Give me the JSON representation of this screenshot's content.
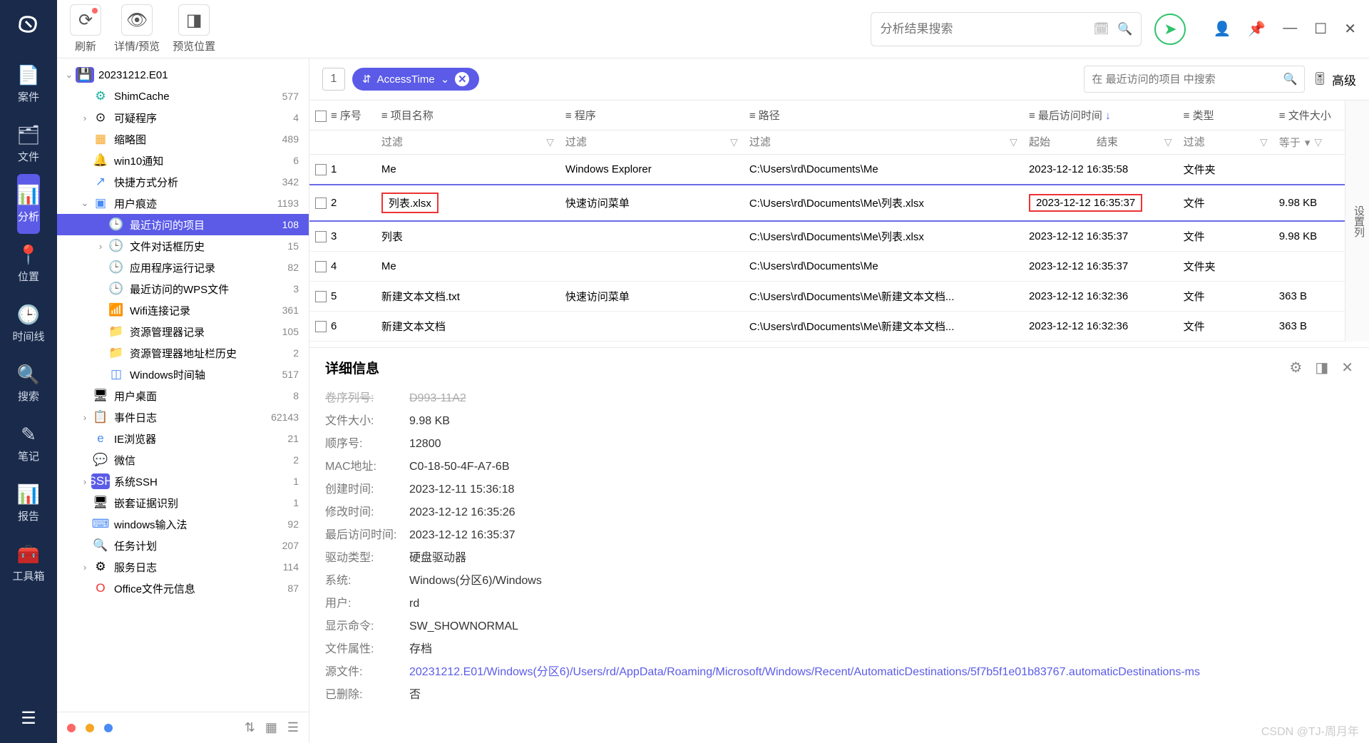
{
  "nav": [
    {
      "icon": "📄",
      "label": "案件"
    },
    {
      "icon": "🗂",
      "label": "文件"
    },
    {
      "icon": "📊",
      "label": "分析",
      "active": true
    },
    {
      "icon": "📍",
      "label": "位置"
    },
    {
      "icon": "🕒",
      "label": "时间线"
    },
    {
      "icon": "🔍",
      "label": "搜索"
    },
    {
      "icon": "✎",
      "label": "笔记"
    },
    {
      "icon": "📊",
      "label": "报告"
    },
    {
      "icon": "🧰",
      "label": "工具箱"
    }
  ],
  "toolbar": {
    "refresh": "刷新",
    "detail_preview": "详情/预览",
    "preview_pos": "预览位置",
    "search_placeholder": "分析结果搜索"
  },
  "tree": {
    "root": "20231212.E01",
    "items": [
      {
        "indent": 1,
        "chev": "",
        "icon": "⚙",
        "iconCls": "ic-teal",
        "label": "ShimCache",
        "count": "577"
      },
      {
        "indent": 1,
        "chev": "›",
        "icon": "⊙",
        "iconCls": "",
        "label": "可疑程序",
        "count": "4"
      },
      {
        "indent": 1,
        "chev": "",
        "icon": "▦",
        "iconCls": "ic-orange",
        "label": "缩略图",
        "count": "489"
      },
      {
        "indent": 1,
        "chev": "",
        "icon": "🔔",
        "iconCls": "ic-blue",
        "label": "win10通知",
        "count": "6"
      },
      {
        "indent": 1,
        "chev": "",
        "icon": "↗",
        "iconCls": "ic-blue",
        "label": "快捷方式分析",
        "count": "342"
      },
      {
        "indent": 1,
        "chev": "⌄",
        "icon": "▣",
        "iconCls": "ic-blue",
        "label": "用户痕迹",
        "count": "1193"
      },
      {
        "indent": 2,
        "chev": "",
        "icon": "🕒",
        "iconCls": "ic-orange",
        "label": "最近访问的项目",
        "count": "108",
        "active": true
      },
      {
        "indent": 2,
        "chev": "›",
        "icon": "🕒",
        "iconCls": "ic-orange",
        "label": "文件对话框历史",
        "count": "15"
      },
      {
        "indent": 2,
        "chev": "",
        "icon": "🕒",
        "iconCls": "ic-orange",
        "label": "应用程序运行记录",
        "count": "82"
      },
      {
        "indent": 2,
        "chev": "",
        "icon": "🕒",
        "iconCls": "ic-orange",
        "label": "最近访问的WPS文件",
        "count": "3"
      },
      {
        "indent": 2,
        "chev": "",
        "icon": "📶",
        "iconCls": "ic-blue",
        "label": "Wifi连接记录",
        "count": "361"
      },
      {
        "indent": 2,
        "chev": "",
        "icon": "📁",
        "iconCls": "ic-fold",
        "label": "资源管理器记录",
        "count": "105"
      },
      {
        "indent": 2,
        "chev": "",
        "icon": "📁",
        "iconCls": "ic-fold",
        "label": "资源管理器地址栏历史",
        "count": "2"
      },
      {
        "indent": 2,
        "chev": "",
        "icon": "◫",
        "iconCls": "ic-blue",
        "label": "Windows时间轴",
        "count": "517"
      },
      {
        "indent": 1,
        "chev": "",
        "icon": "🖥",
        "iconCls": "",
        "label": "用户桌面",
        "count": "8"
      },
      {
        "indent": 1,
        "chev": "›",
        "icon": "📋",
        "iconCls": "ic-orange",
        "label": "事件日志",
        "count": "62143"
      },
      {
        "indent": 1,
        "chev": "",
        "icon": "e",
        "iconCls": "ic-blue",
        "label": "IE浏览器",
        "count": "21"
      },
      {
        "indent": 1,
        "chev": "",
        "icon": "💬",
        "iconCls": "ic-green",
        "label": "微信",
        "count": "2"
      },
      {
        "indent": 1,
        "chev": "›",
        "icon": "SSH",
        "iconCls": "ic-disk",
        "label": "系统SSH",
        "count": "1"
      },
      {
        "indent": 1,
        "chev": "",
        "icon": "🖥",
        "iconCls": "",
        "label": "嵌套证据识别",
        "count": "1"
      },
      {
        "indent": 1,
        "chev": "",
        "icon": "⌨",
        "iconCls": "ic-blue",
        "label": "windows输入法",
        "count": "92"
      },
      {
        "indent": 1,
        "chev": "",
        "icon": "🔍",
        "iconCls": "ic-blue",
        "label": "任务计划",
        "count": "207"
      },
      {
        "indent": 1,
        "chev": "›",
        "icon": "⚙",
        "iconCls": "",
        "label": "服务日志",
        "count": "114"
      },
      {
        "indent": 1,
        "chev": "",
        "icon": "O",
        "iconCls": "ic-red",
        "label": "Office文件元信息",
        "count": "87"
      }
    ]
  },
  "filter": {
    "pill": "AccessTime",
    "search_ph": "在 最近访问的项目 中搜索",
    "adv": "高级"
  },
  "table": {
    "side_tab": "设置列",
    "headers": {
      "seq": "序号",
      "name": "项目名称",
      "prog": "程序",
      "path": "路径",
      "atime": "最后访问时间",
      "type": "类型",
      "size": "文件大小"
    },
    "filters": {
      "ph": "过滤",
      "start": "起始",
      "end": "结束",
      "eq": "等于"
    },
    "rows": [
      {
        "n": "1",
        "name": "Me",
        "prog": "Windows Explorer",
        "path": "C:\\Users\\rd\\Documents\\Me",
        "atime": "2023-12-12 16:35:58",
        "type": "文件夹",
        "size": ""
      },
      {
        "n": "2",
        "name": "列表.xlsx",
        "prog": "快速访问菜单",
        "path": "C:\\Users\\rd\\Documents\\Me\\列表.xlsx",
        "atime": "2023-12-12 16:35:37",
        "type": "文件",
        "size": "9.98 KB",
        "selected": true,
        "nameBox": true,
        "timeBox": true
      },
      {
        "n": "3",
        "name": "列表",
        "prog": "",
        "path": "C:\\Users\\rd\\Documents\\Me\\列表.xlsx",
        "atime": "2023-12-12 16:35:37",
        "type": "文件",
        "size": "9.98 KB"
      },
      {
        "n": "4",
        "name": "Me",
        "prog": "",
        "path": "C:\\Users\\rd\\Documents\\Me",
        "atime": "2023-12-12 16:35:37",
        "type": "文件夹",
        "size": ""
      },
      {
        "n": "5",
        "name": "新建文本文档.txt",
        "prog": "快速访问菜单",
        "path": "C:\\Users\\rd\\Documents\\Me\\新建文本文档...",
        "atime": "2023-12-12 16:32:36",
        "type": "文件",
        "size": "363 B"
      },
      {
        "n": "6",
        "name": "新建文本文档",
        "prog": "",
        "path": "C:\\Users\\rd\\Documents\\Me\\新建文本文档...",
        "atime": "2023-12-12 16:32:36",
        "type": "文件",
        "size": "363 B"
      }
    ]
  },
  "details": {
    "title": "详细信息",
    "rows": [
      {
        "label": "卷序列号:",
        "val": "D993-11A2",
        "strike": true
      },
      {
        "label": "文件大小:",
        "val": "9.98 KB"
      },
      {
        "label": "顺序号:",
        "val": "12800"
      },
      {
        "label": "MAC地址:",
        "val": "C0-18-50-4F-A7-6B"
      },
      {
        "label": "创建时间:",
        "val": "2023-12-11 15:36:18"
      },
      {
        "label": "修改时间:",
        "val": "2023-12-12 16:35:26"
      },
      {
        "label": "最后访问时间:",
        "val": "2023-12-12 16:35:37"
      },
      {
        "label": "驱动类型:",
        "val": "硬盘驱动器"
      },
      {
        "label": "系统:",
        "val": "Windows(分区6)/Windows"
      },
      {
        "label": "用户:",
        "val": "rd"
      },
      {
        "label": "显示命令:",
        "val": "SW_SHOWNORMAL"
      },
      {
        "label": "文件属性:",
        "val": "存档"
      },
      {
        "label": "源文件:",
        "val": "20231212.E01/Windows(分区6)/Users/rd/AppData/Roaming/Microsoft/Windows/Recent/AutomaticDestinations/5f7b5f1e01b83767.automaticDestinations-ms",
        "link": true
      },
      {
        "label": "已删除:",
        "val": "否"
      }
    ]
  },
  "watermark": "CSDN @TJ-周月年"
}
